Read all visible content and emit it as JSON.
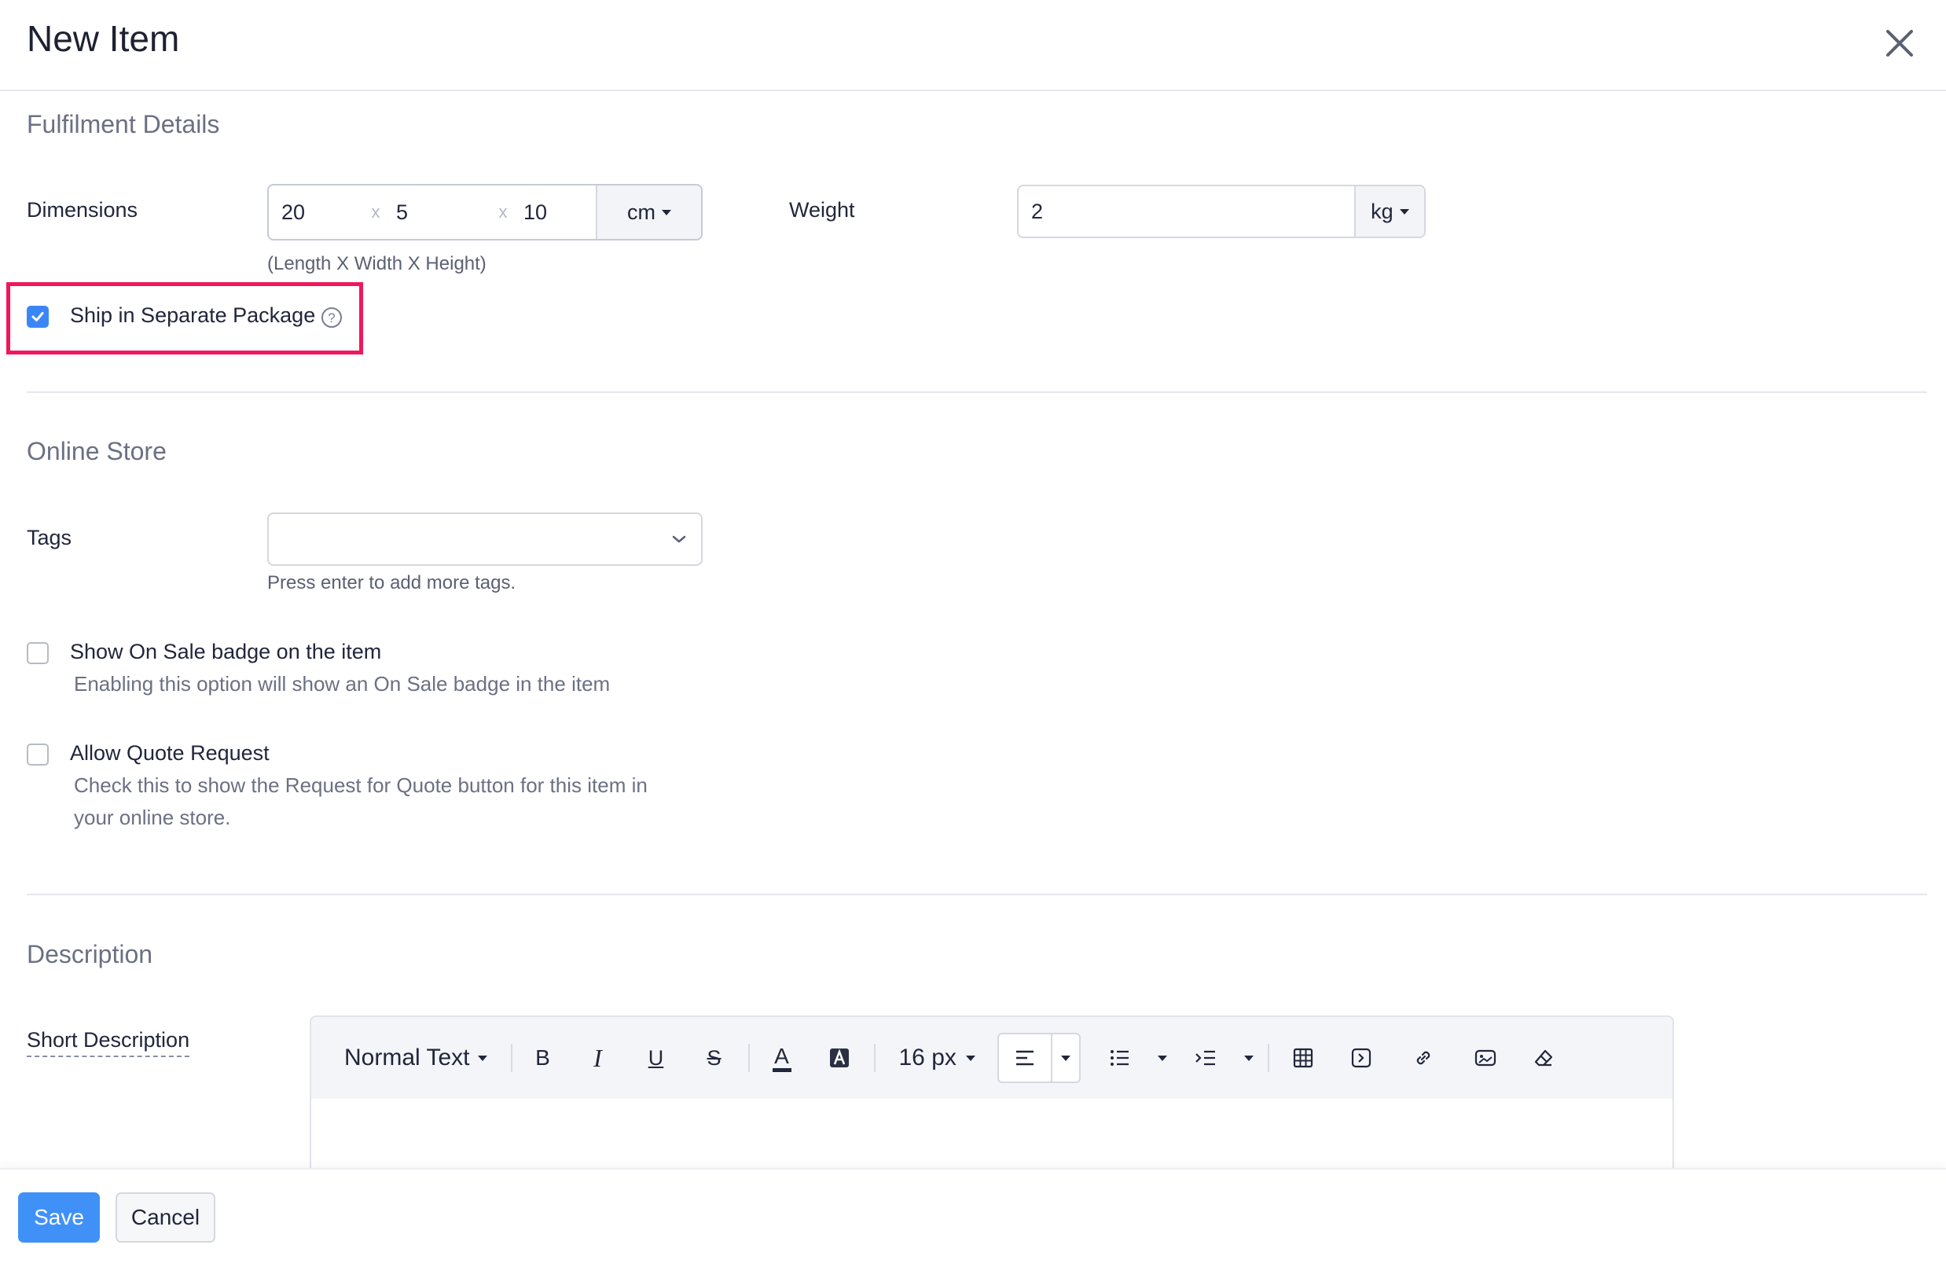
{
  "header": {
    "title": "New Item"
  },
  "fulfilment": {
    "title": "Fulfilment Details",
    "dimensions": {
      "label": "Dimensions",
      "length": "20",
      "width": "5",
      "height": "10",
      "separator": "x",
      "unit": "cm",
      "hint": "(Length X Width X Height)"
    },
    "weight": {
      "label": "Weight",
      "value": "2",
      "unit": "kg"
    },
    "ship_separate": {
      "label": "Ship in Separate Package",
      "checked": true
    }
  },
  "online_store": {
    "title": "Online Store",
    "tags": {
      "label": "Tags",
      "value": "",
      "hint": "Press enter to add more tags."
    },
    "on_sale": {
      "label": "Show On Sale badge on the item",
      "description": "Enabling this option will show an On Sale badge in the item",
      "checked": false
    },
    "quote": {
      "label": "Allow Quote Request",
      "description_line1": "Check this to show the Request for Quote button for this item in",
      "description_line2": "your online store.",
      "checked": false
    }
  },
  "description": {
    "title": "Description",
    "short_label": "Short Description",
    "toolbar": {
      "text_style": "Normal Text",
      "bold": "B",
      "italic": "I",
      "underline": "U",
      "strike": "S",
      "font_color": "A",
      "font_size": "16 px"
    }
  },
  "footer": {
    "save": "Save",
    "cancel": "Cancel"
  },
  "colors": {
    "accent": "#4091f7",
    "highlight": "#f0185c",
    "checkbox": "#3b86f5"
  }
}
